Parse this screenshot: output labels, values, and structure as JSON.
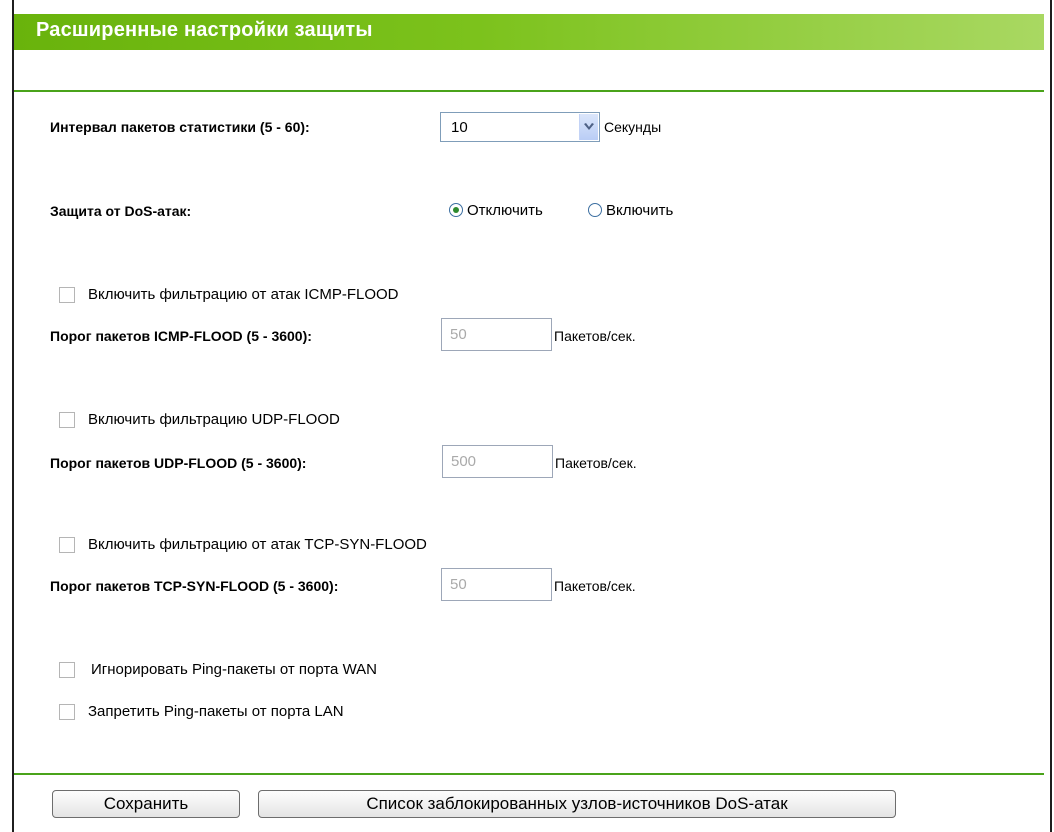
{
  "header": {
    "title": "Расширенные настройки защиты"
  },
  "stats_interval": {
    "label": "Интервал пакетов статистики (5 - 60):",
    "selected": "10",
    "unit": "Секунды"
  },
  "dos_protection": {
    "label": "Защита от DoS-атак:",
    "options": [
      {
        "label": "Отключить",
        "selected": true
      },
      {
        "label": "Включить",
        "selected": false
      }
    ]
  },
  "icmp": {
    "checkbox_label": "Включить фильтрацию от атак ICMP-FLOOD",
    "threshold_label": "Порог пакетов ICMP-FLOOD (5 - 3600):",
    "value": "50",
    "unit": "Пакетов/сек."
  },
  "udp": {
    "checkbox_label": "Включить фильтрацию UDP-FLOOD",
    "threshold_label": "Порог пакетов UDP-FLOOD (5 - 3600):",
    "value": "500",
    "unit": "Пакетов/сек."
  },
  "tcp": {
    "checkbox_label": "Включить фильтрацию от атак TCP-SYN-FLOOD",
    "threshold_label": "Порог пакетов TCP-SYN-FLOOD (5 - 3600):",
    "value": "50",
    "unit": "Пакетов/сек."
  },
  "ping": {
    "ignore_wan_label": "Игнорировать Ping-пакеты от порта WAN",
    "forbid_lan_label": "Запретить Ping-пакеты от порта LAN"
  },
  "buttons": {
    "save": "Сохранить",
    "blocked_list": "Список заблокированных узлов-источников DoS-атак"
  },
  "colors": {
    "accent": "#69b30c",
    "divider": "#4aa31a"
  }
}
